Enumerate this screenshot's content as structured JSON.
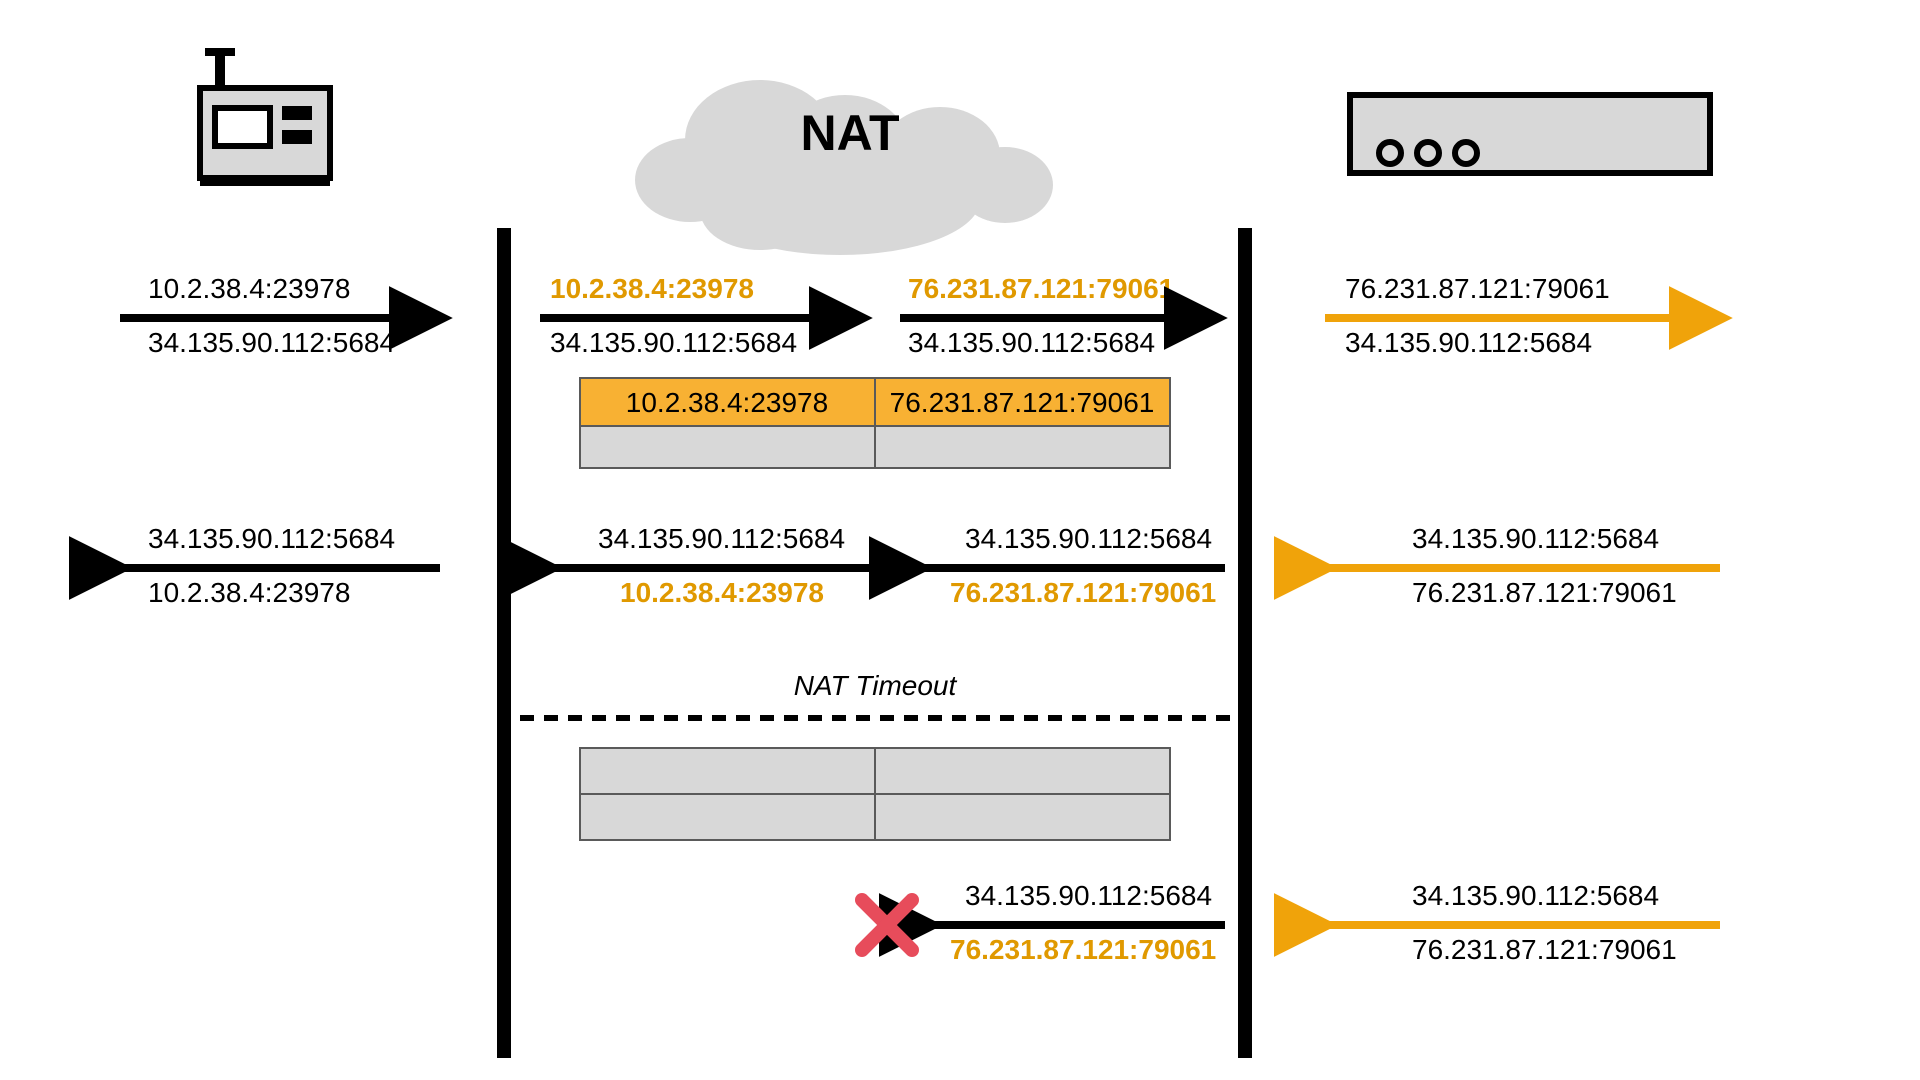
{
  "colors": {
    "accent": "#f0a30a",
    "accent_dark": "#e09900",
    "accent_fill": "#f8b133",
    "grey": "#d8d8d8",
    "red": "#e74c5b"
  },
  "title": "NAT",
  "timeout_label": "NAT Timeout",
  "addr": {
    "client_int": "10.2.38.4:23978",
    "server_ext": "34.135.90.112:5684",
    "nat_ext": "76.231.87.121:79061"
  },
  "rows": {
    "r1": {
      "col1_top": "10.2.38.4:23978",
      "col1_bot": "34.135.90.112:5684",
      "col2_top": "10.2.38.4:23978",
      "col2_bot": "34.135.90.112:5684",
      "col3_top": "76.231.87.121:79061",
      "col3_bot": "34.135.90.112:5684",
      "col4_top": "76.231.87.121:79061",
      "col4_bot": "34.135.90.112:5684"
    },
    "r2": {
      "col1_top": "34.135.90.112:5684",
      "col1_bot": "10.2.38.4:23978",
      "col2_top": "34.135.90.112:5684",
      "col2_bot": "10.2.38.4:23978",
      "col3_top": "34.135.90.112:5684",
      "col3_bot": "76.231.87.121:79061",
      "col4_top": "34.135.90.112:5684",
      "col4_bot": "76.231.87.121:79061"
    },
    "r3": {
      "col3_top": "34.135.90.112:5684",
      "col3_bot": "76.231.87.121:79061",
      "col4_top": "34.135.90.112:5684",
      "col4_bot": "76.231.87.121:79061"
    }
  },
  "nat_table": {
    "left": "10.2.38.4:23978",
    "right": "76.231.87.121:79061"
  }
}
